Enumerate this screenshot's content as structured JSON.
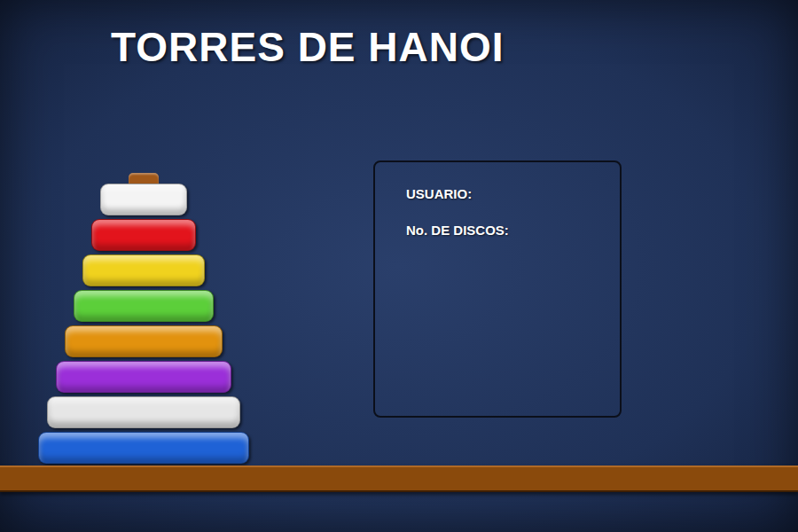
{
  "title": "TORRES DE HANOI",
  "tower": {
    "disks": [
      {
        "color": "#f4f4f4"
      },
      {
        "color": "#e3141c"
      },
      {
        "color": "#f0d21e"
      },
      {
        "color": "#5ccf3a"
      },
      {
        "color": "#e2920e"
      },
      {
        "color": "#9b2fd9"
      },
      {
        "color": "#e6e6e6"
      },
      {
        "color": "#1f62d6"
      }
    ]
  },
  "info_panel": {
    "fields": [
      {
        "label": "USUARIO:"
      },
      {
        "label": "No. DE DISCOS:"
      }
    ]
  }
}
